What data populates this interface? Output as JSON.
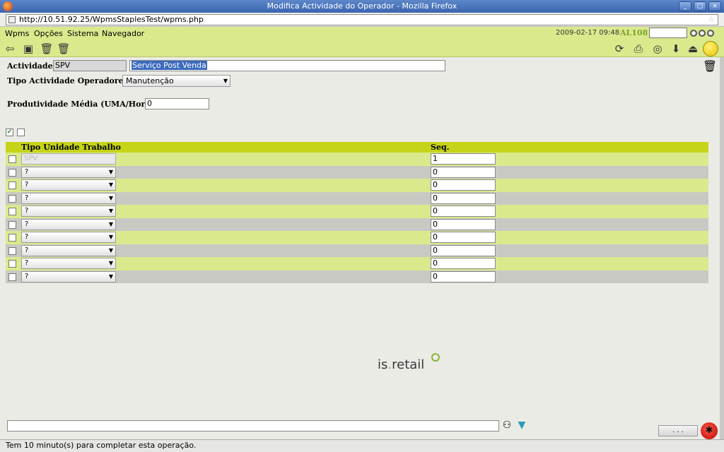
{
  "window": {
    "title": "Modifica Actividade do Operador - Mozilla Firefox",
    "controls": [
      "_",
      "□",
      "×"
    ]
  },
  "browser": {
    "url": "http://10.51.92.25/WpmsStaplesTest/wpms.php"
  },
  "menu": {
    "items": [
      "Wpms",
      "Opções",
      "Sistema",
      "Navegador"
    ]
  },
  "header": {
    "datetime": "2009-02-17 09:48",
    "user": "AL108",
    "search_value": ""
  },
  "toolbar": {
    "left_icons": [
      "back-arrow-icon",
      "save-icon",
      "delete-icon",
      "copy-delete-icon"
    ],
    "right_icons": [
      "refresh-icon",
      "print-icon",
      "help-lifebuoy-icon",
      "download-icon",
      "export-icon",
      "status-yellow-icon"
    ]
  },
  "form": {
    "actividade_label": "Actividade:",
    "actividade_code": "SPV",
    "actividade_desc": "Serviço Post Venda",
    "tipo_label": "Tipo Actividade Operadores:",
    "tipo_value": "Manutenção",
    "produtividade_label": "Produtividade Média (UMA/Hora):",
    "produtividade_value": "0"
  },
  "table": {
    "headers": {
      "tipo": "Tipo Unidade Trabalho",
      "seq": "Seq."
    },
    "rows": [
      {
        "tipo": "SPV",
        "seq": "1",
        "readonly": true
      },
      {
        "tipo": "?",
        "seq": "0"
      },
      {
        "tipo": "?",
        "seq": "0"
      },
      {
        "tipo": "?",
        "seq": "0"
      },
      {
        "tipo": "?",
        "seq": "0"
      },
      {
        "tipo": "?",
        "seq": "0"
      },
      {
        "tipo": "?",
        "seq": "0"
      },
      {
        "tipo": "?",
        "seq": "0"
      },
      {
        "tipo": "?",
        "seq": "0"
      },
      {
        "tipo": "?",
        "seq": "0"
      }
    ]
  },
  "brand": {
    "logo_prefix": "is",
    "logo_dot": ".",
    "logo_suffix": "retail",
    "accent": "#8ab43a"
  },
  "footer": {
    "dots_button": ". . .",
    "status": "Tem 10 minuto(s) para completar esta operação."
  },
  "colors": {
    "menu_bg": "#dbe98d",
    "header_bg": "#c6d419",
    "row_odd": "#dbe98d",
    "row_even": "#c9c9c3"
  }
}
